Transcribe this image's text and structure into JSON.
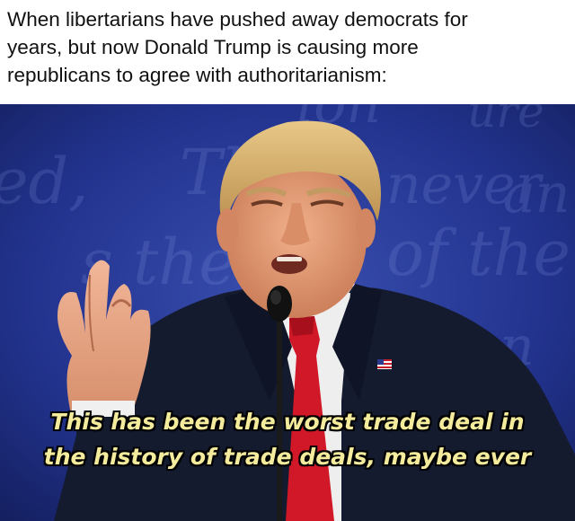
{
  "caption": {
    "line1": "When libertarians have pushed away democrats for",
    "line2": "years, but now Donald Trump is causing more",
    "line3": "republicans to agree with authoritarianism:"
  },
  "subtitle": {
    "line1": "This has been the worst trade deal in",
    "line2": "the history of trade deals, maybe ever"
  },
  "colors": {
    "background_blue": "#1e2f86",
    "suit": "#141b2f",
    "tie": "#d01828",
    "skin": "#e9a27a",
    "hair": "#d8b26e",
    "subtitle_text": "#f4ec9c"
  }
}
